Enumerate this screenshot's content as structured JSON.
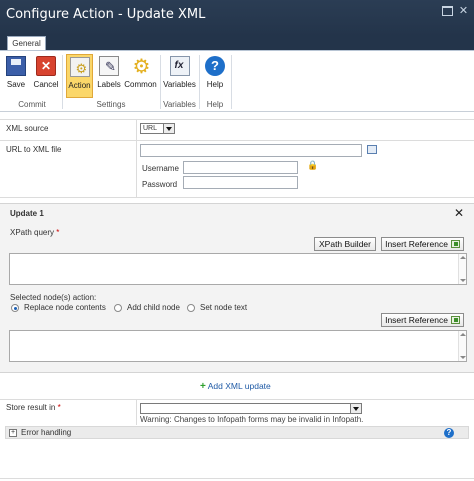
{
  "window": {
    "title": "Configure Action - Update XML"
  },
  "ribbon": {
    "tab": "General",
    "buttons": {
      "save": "Save",
      "cancel": "Cancel",
      "action": "Action",
      "labels": "Labels",
      "common": "Common",
      "variables": "Variables",
      "help": "Help"
    },
    "groups": {
      "commit": "Commit",
      "settings": "Settings",
      "variables": "Variables",
      "help": "Help"
    }
  },
  "form": {
    "xml_source": {
      "label": "XML source",
      "value": "URL"
    },
    "url": {
      "label": "URL to XML file",
      "value": ""
    },
    "username": {
      "label": "Username",
      "value": ""
    },
    "password": {
      "label": "Password",
      "value": ""
    },
    "update": {
      "title": "Update 1",
      "xpath_label": "XPath query",
      "required_mark": "*",
      "xpath_builder": "XPath Builder",
      "insert_reference": "Insert Reference",
      "xpath_value": "",
      "action_label": "Selected node(s) action:",
      "options": [
        "Replace node contents",
        "Add child node",
        "Set node text"
      ],
      "selected_option": "Replace node contents",
      "content_value": ""
    },
    "add_update": "Add XML update",
    "store_result": {
      "label": "Store result in",
      "required_mark": "*",
      "value": "",
      "warning": "Warning: Changes to Infopath forms may be invalid in Infopath."
    },
    "error_handling": {
      "label": "Error handling",
      "expand": "+"
    }
  },
  "colors": {
    "title_bar": "#23344a",
    "active_button": "#fbd76a",
    "link": "#1f5aa6"
  }
}
